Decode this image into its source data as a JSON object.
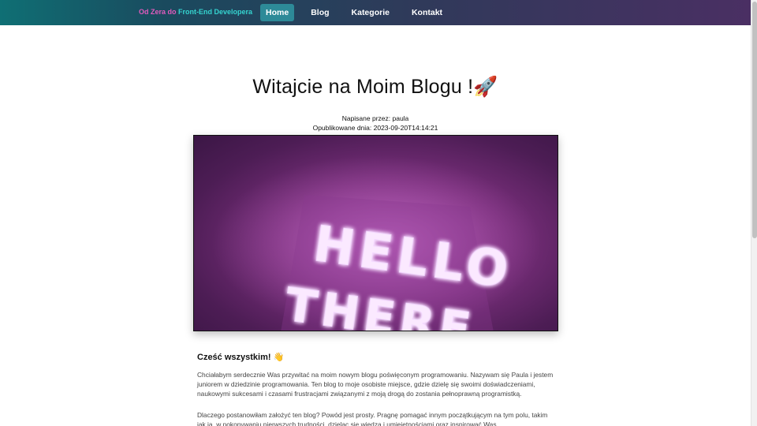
{
  "brand": {
    "part1": "Od Zera do",
    "part2": "Front-End Developera"
  },
  "nav": {
    "items": [
      {
        "label": "Home",
        "active": true
      },
      {
        "label": "Blog",
        "active": false
      },
      {
        "label": "Kategorie",
        "active": false
      },
      {
        "label": "Kontakt",
        "active": false
      }
    ]
  },
  "post": {
    "title": "Witajcie na Moim Blogu !🚀",
    "author_line": "Napisane przez: paula",
    "date_line": "Opublikowane dnia: 2023-09-20T14:14:21",
    "image_text": "HELLO THERE",
    "greeting": "Cześć wszystkim! 👋",
    "paragraph1": "Chciałabym serdecznie Was przywitać na moim nowym blogu poświęconym programowaniu. Nazywam się Paula i jestem juniorem w dziedzinie programowania. Ten blog to moje osobiste miejsce, gdzie dzielę się swoimi doświadczeniami, naukowymi sukcesami i czasami frustracjami związanymi z moją drogą do zostania pełnoprawną programistką.",
    "paragraph2": "Dlaczego postanowiłam założyć ten blog? Powód jest prosty. Pragnę pomagać innym początkującym na tym polu, takim jak ja, w pokonywaniu pierwszych trudności, dzieląc się wiedzą i umiejętnościami oraz inspirować Was"
  },
  "colors": {
    "nav_active": "#2d8a98",
    "brand_pink": "#e05bbd",
    "brand_teal": "#35d4d0",
    "neon": "#f3d6ff"
  }
}
